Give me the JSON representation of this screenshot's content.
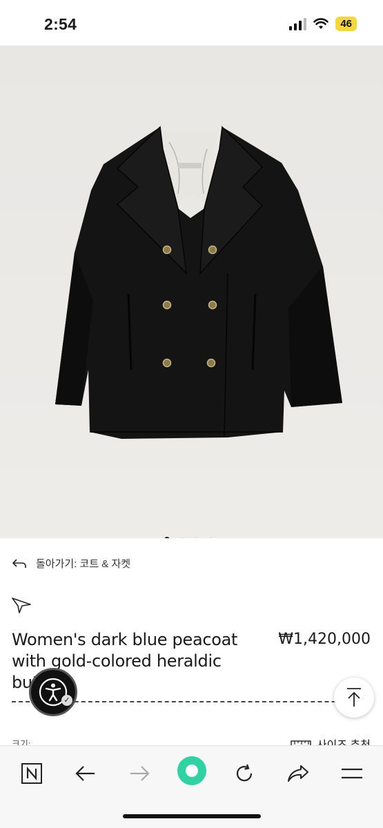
{
  "status_bar": {
    "time": "2:54",
    "battery": "46",
    "icons": [
      "signal-icon",
      "wifi-icon",
      "battery-icon"
    ]
  },
  "carousel": {
    "image_alt": "Women's dark blue peacoat with gold-colored heraldic buttons",
    "dot_count": 4,
    "active_index": 0,
    "next_label": "→"
  },
  "breadcrumb": {
    "icon": "back-arrow-icon",
    "label": "돌아가기: 코트 & 자켓"
  },
  "product": {
    "title": "Women's dark blue peacoat with gold-colored heraldic buttons",
    "price": "₩1,420,000",
    "wishlist_icon": "star-pin-icon"
  },
  "size": {
    "label": "크기:",
    "guide_label": "사이즈 추천",
    "guide_icon": "ruler-icon"
  },
  "floating": {
    "accessibility_icon": "accessibility-icon",
    "scroll_top_icon": "arrow-up-icon"
  },
  "toolbar": {
    "items": [
      "naver-icon",
      "back-icon",
      "forward-icon",
      "home-green-icon",
      "refresh-icon",
      "share-icon",
      "menu-icon"
    ]
  },
  "colors": {
    "hero_bg": "#ebe9e6",
    "coat": "#141414",
    "accent_green": "#2fd2a3",
    "battery": "#f4d73c"
  }
}
